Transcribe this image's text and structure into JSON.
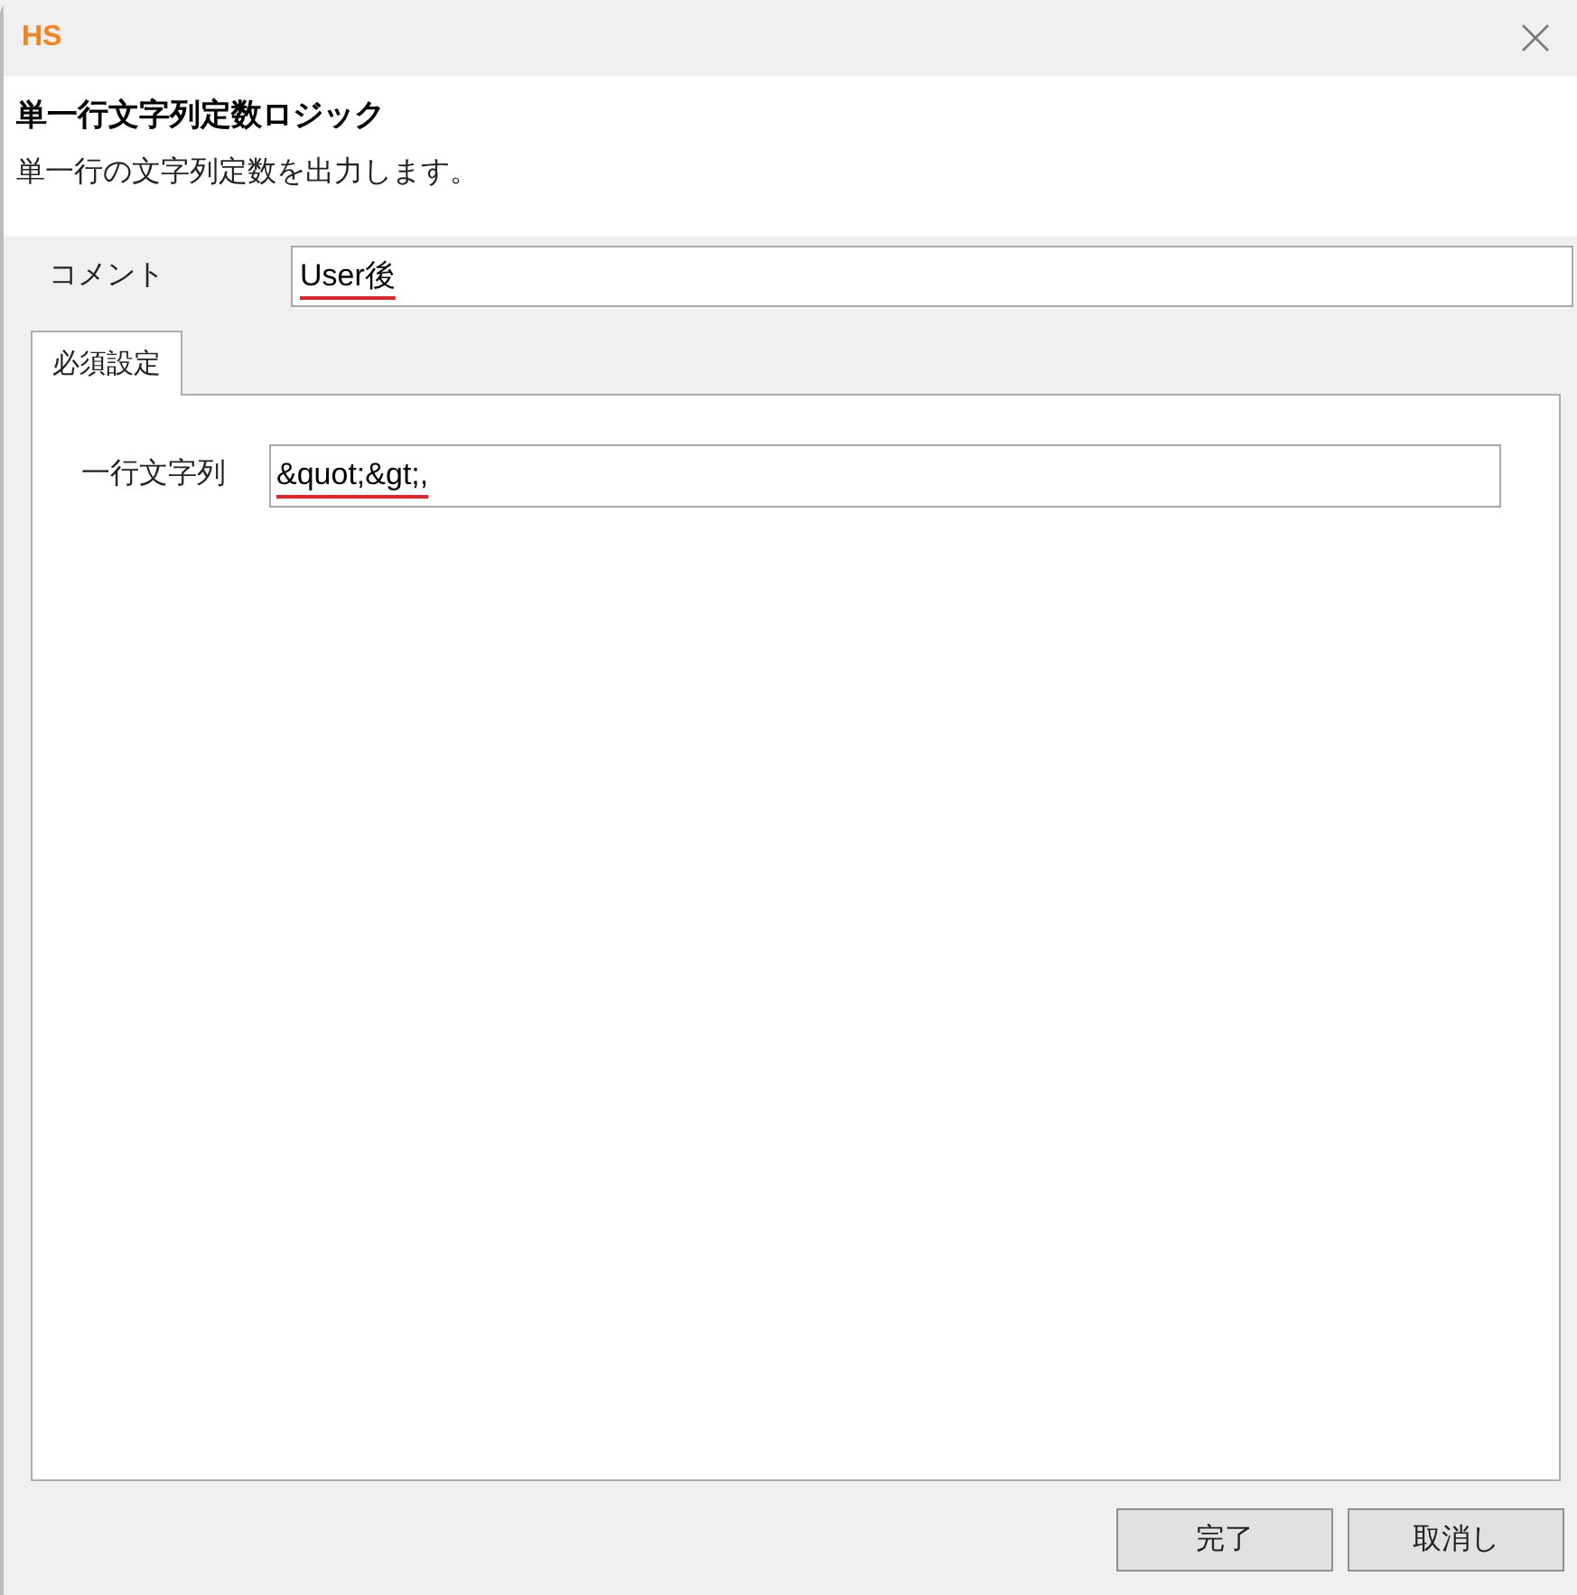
{
  "window": {
    "logo": "HS"
  },
  "header": {
    "title": "単一行文字列定数ロジック",
    "description": "単一行の文字列定数を出力します。"
  },
  "comment": {
    "label": "コメント",
    "value": "User後",
    "flagged": true
  },
  "tabs": [
    {
      "label": "必須設定",
      "selected": true
    }
  ],
  "fields": [
    {
      "label": "一行文字列",
      "value": "&quot;&gt;,",
      "flagged": true
    }
  ],
  "buttons": [
    "完了",
    "取消し"
  ]
}
